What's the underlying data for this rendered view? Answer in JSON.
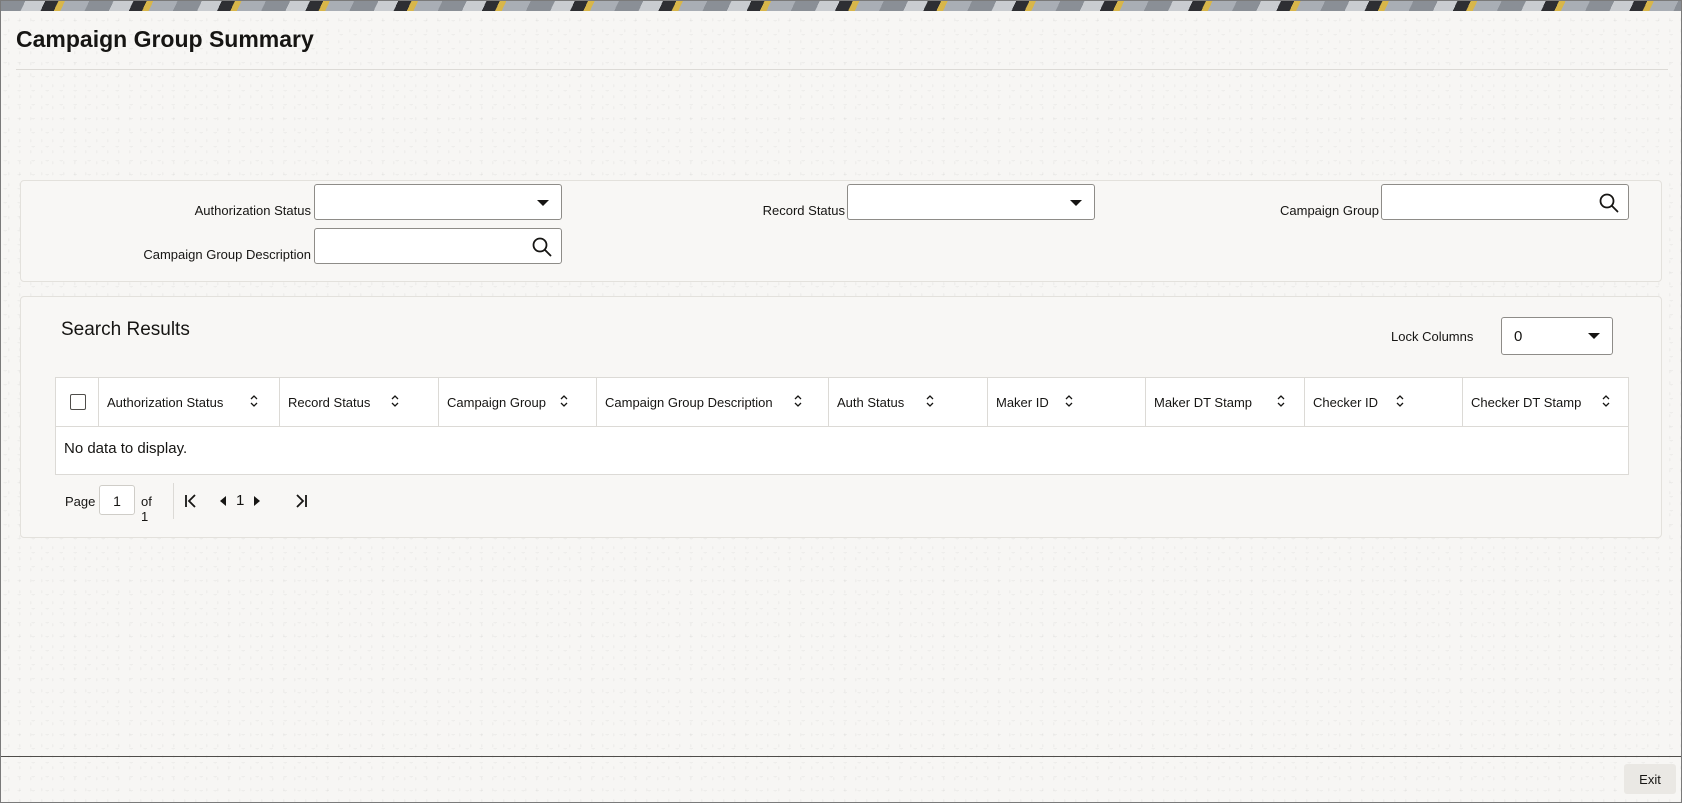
{
  "page": {
    "title": "Campaign Group Summary"
  },
  "criteria": {
    "authorization_status": {
      "label": "Authorization Status",
      "value": ""
    },
    "record_status": {
      "label": "Record Status",
      "value": ""
    },
    "campaign_group": {
      "label": "Campaign Group",
      "value": ""
    },
    "campaign_group_description": {
      "label": "Campaign Group Description",
      "value": ""
    }
  },
  "results": {
    "title": "Search Results",
    "lock_columns": {
      "label": "Lock Columns",
      "value": "0"
    },
    "columns": [
      "Authorization Status",
      "Record Status",
      "Campaign Group",
      "Campaign Group Description",
      "Auth Status",
      "Maker ID",
      "Maker DT Stamp",
      "Checker ID",
      "Checker DT Stamp"
    ],
    "empty_message": "No data to display."
  },
  "pagination": {
    "page_label": "Page",
    "current_page": "1",
    "of_label": "of 1",
    "nav_page": "1"
  },
  "footer": {
    "exit_label": "Exit"
  },
  "icons": {
    "dropdown": "caret-down-icon",
    "search": "search-icon",
    "sort": "sort-icon",
    "first": "first-page-icon",
    "prev": "previous-page-icon",
    "next": "next-page-icon",
    "last": "last-page-icon"
  }
}
